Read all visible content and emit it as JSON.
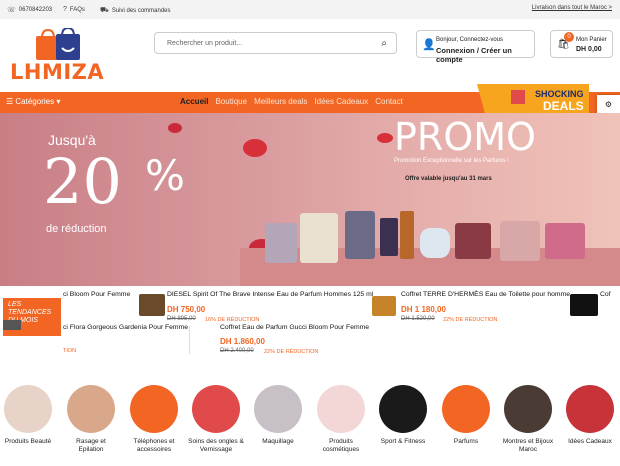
{
  "topbar": {
    "phone": "0670842203",
    "faqs": "FAQs",
    "orders": "Suivi des commandes",
    "shipping": "Livraison dans tout le Maroc >"
  },
  "brand": {
    "name": "LHMIZA",
    "accent": "#f26522"
  },
  "search": {
    "placeholder": "Rechercher un produit..."
  },
  "account": {
    "line1": "Bonjour, Connectez-vous",
    "line2": "Connexion / Créer un compte"
  },
  "cart": {
    "label": "Mon Panier",
    "total": "DH 0,00",
    "count": "0"
  },
  "nav": {
    "categories": "Catégories",
    "links": [
      "Accueil",
      "Boutique",
      "Meilleurs deals",
      "Idées Cadeaux",
      "Contact"
    ]
  },
  "promo_badge": {
    "text": "Shocking DEALS"
  },
  "hero": {
    "jusqua": "Jusqu'à",
    "percent": "20",
    "percent_sign": "%",
    "reduction": "de réduction",
    "promo": "PROMO",
    "sub": "Promotion Exceptionnelle sur les Parfums !",
    "offre": "Offre valable jusqu'au 31 mars"
  },
  "ticker": {
    "label": "LES TENDANCES DU MOIS",
    "items": [
      {
        "name": "ci Bloom Pour Femme"
      },
      {
        "name": "DIESEL Spirit Of The Brave Intense Eau de Parfum Hommes 125 ml",
        "price": "DH 750,00",
        "old": "DH 895,00",
        "disc": "16% DE RÉDUCTION"
      },
      {
        "name": "Coffret TERRE D'HERMÈS Eau de Toilette pour homme",
        "price": "DH 1 180,00",
        "old": "DH 1.520,00",
        "disc": "22% DE RÉDUCTION"
      },
      {
        "name": "Cof"
      },
      {
        "name": "ci Flora Gorgeous Gardenia Pour Femme",
        "disc": "TION"
      },
      {
        "name": "Coffret Eau de Parfum Gucci Bloom Pour Femme",
        "price": "DH 1.860,00",
        "old": "DH 2.400,00",
        "disc": "22% DE RÉDUCTION"
      }
    ]
  },
  "categories": [
    {
      "label": "Produits Beauté",
      "color": "#e8d3c8"
    },
    {
      "label": "Rasage et Epilation",
      "color": "#d9a88a"
    },
    {
      "label": "Téléphones et accessoires",
      "color": "#f26522"
    },
    {
      "label": "Soins des ongles & Vernissage",
      "color": "#e04a4a"
    },
    {
      "label": "Maquillage",
      "color": "#c7c0c6"
    },
    {
      "label": "Produits cosmétiques",
      "color": "#f3d6d6"
    },
    {
      "label": "Sport & Fitness",
      "color": "#1a1a1a"
    },
    {
      "label": "Parfums",
      "color": "#f26522"
    },
    {
      "label": "Montres et Bijoux Maroc",
      "color": "#4a3b35"
    },
    {
      "label": "Idées Cadeaux",
      "color": "#c8333a"
    }
  ]
}
